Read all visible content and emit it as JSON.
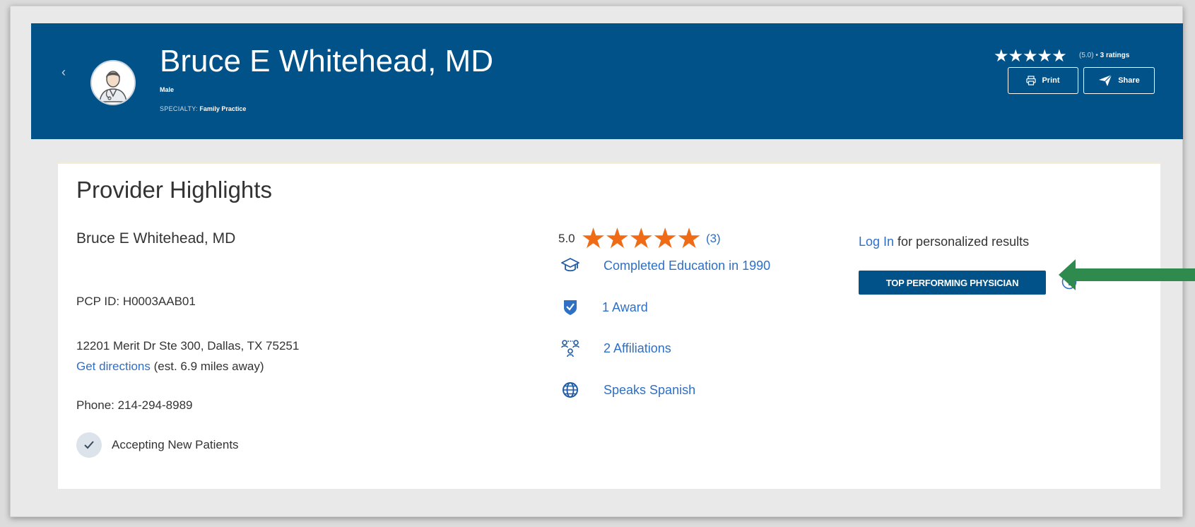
{
  "header": {
    "back_label": "‹",
    "provider_name": "Bruce E Whitehead, MD",
    "gender": "Male",
    "specialty_label": "SPECIALTY:",
    "specialty_value": "Family Practice",
    "stars": "★★★★★",
    "rating_value": "(5.0) •",
    "rating_count": "3 ratings",
    "print_label": "Print",
    "share_label": "Share"
  },
  "card": {
    "title": "Provider Highlights",
    "doctor_name": "Bruce E Whitehead, MD",
    "pcp_id": "PCP ID: H0003AAB01",
    "address": "12201 Merit Dr Ste 300, Dallas, TX 75251",
    "directions_link": "Get directions",
    "directions_distance": "(est. 6.9 miles away)",
    "phone": "Phone: 214-294-8989",
    "accepting": "Accepting New Patients",
    "rating": {
      "score": "5.0",
      "stars": "★★★★★",
      "count": "(3)",
      "value": 5
    },
    "highlights": [
      {
        "icon": "graduation-cap-icon",
        "label": "Completed Education in 1990"
      },
      {
        "icon": "award-shield-icon",
        "label": "1 Award"
      },
      {
        "icon": "affiliations-icon",
        "label": "2 Affiliations"
      },
      {
        "icon": "globe-icon",
        "label": "Speaks Spanish"
      }
    ],
    "login_link": "Log In",
    "login_text": " for personalized results",
    "badge": "TOP PERFORMING PHYSICIAN"
  },
  "colors": {
    "header_bg": "#005288",
    "link": "#2f6fc4",
    "star_orange": "#ef6b15",
    "arrow_green": "#2e8a4d",
    "badge_bg": "#005288"
  }
}
